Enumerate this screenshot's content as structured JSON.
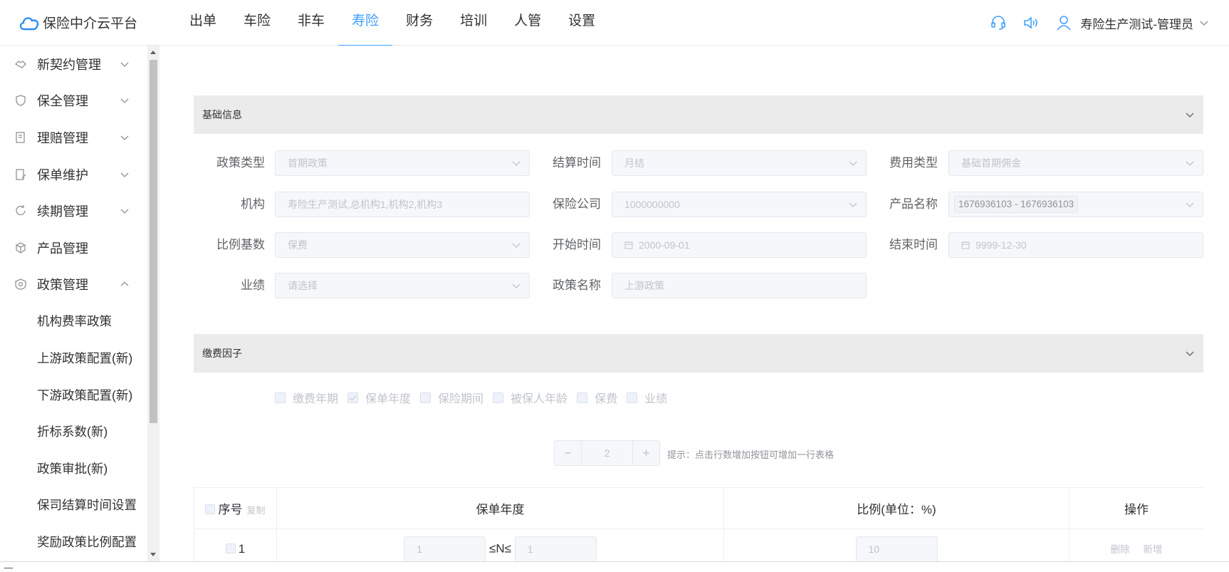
{
  "app": {
    "title": "保险中介云平台"
  },
  "nav": [
    "出单",
    "车险",
    "非车",
    "寿险",
    "财务",
    "培训",
    "人管",
    "设置"
  ],
  "user": {
    "name": "寿险生产测试-管理员"
  },
  "sidebar": {
    "groups": [
      "新契约管理",
      "保全管理",
      "理赔管理",
      "保单维护",
      "续期管理",
      "产品管理",
      "政策管理"
    ],
    "sub": [
      "机构费率政策",
      "上游政策配置(新)",
      "下游政策配置(新)",
      "折标系数(新)",
      "政策审批(新)",
      "保司结算时间设置",
      "奖励政策比例配置"
    ]
  },
  "basic": {
    "title": "基础信息",
    "policy_type": {
      "label": "政策类型",
      "value": "首期政策"
    },
    "settle_time": {
      "label": "结算时间",
      "value": "月结"
    },
    "fee_type": {
      "label": "费用类型",
      "value": "基础首期佣金"
    },
    "org": {
      "label": "机构",
      "value": "寿险生产测试,总机构1,机构2,机构3"
    },
    "insurer": {
      "label": "保险公司",
      "value": "1000000000"
    },
    "product": {
      "label": "产品名称",
      "value": "1676936103 - 1676936103"
    },
    "ratio_base": {
      "label": "比例基数",
      "value": "保费"
    },
    "start_time": {
      "label": "开始时间",
      "value": "2000-09-01"
    },
    "end_time": {
      "label": "结束时间",
      "value": "9999-12-30"
    },
    "performance": {
      "label": "业绩",
      "placeholder": "请选择"
    },
    "policy_name": {
      "label": "政策名称",
      "value": "上游政策"
    }
  },
  "factor": {
    "title": "缴费因子",
    "options": [
      {
        "label": "缴费年期",
        "checked": false
      },
      {
        "label": "保单年度",
        "checked": true
      },
      {
        "label": "保险期间",
        "checked": false
      },
      {
        "label": "被保人年龄",
        "checked": false
      },
      {
        "label": "保费",
        "checked": false
      },
      {
        "label": "业绩",
        "checked": false
      }
    ],
    "stepper": {
      "minus": "−",
      "value": "2",
      "plus": "+"
    },
    "hint": "提示：点击行数增加按钮可增加一行表格"
  },
  "table": {
    "headers": {
      "index": "序号",
      "copy": "复制",
      "year": "保单年度",
      "ratio": "比例(单位：%)",
      "ops": "操作"
    },
    "rows": [
      {
        "index": "1",
        "from": "1",
        "op": "≤N≤",
        "to": "1",
        "ratio": "10",
        "del": "删除",
        "add": "新增"
      }
    ]
  }
}
